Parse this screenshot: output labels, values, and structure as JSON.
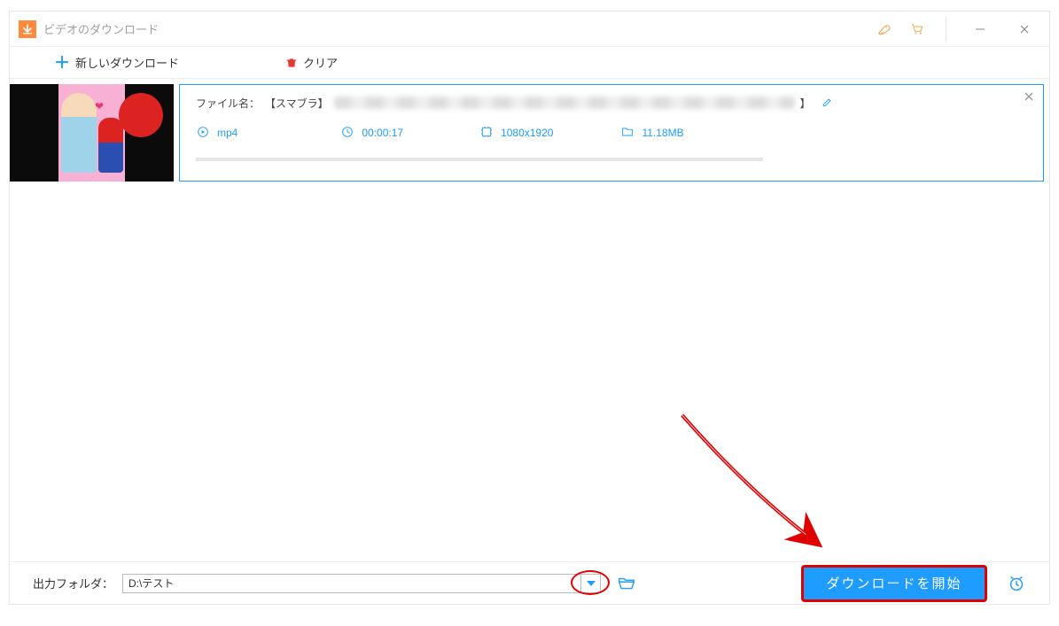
{
  "window": {
    "title": "ビデオのダウンロード"
  },
  "toolbar": {
    "new_download_label": "新しいダウンロード",
    "clear_label": "クリア"
  },
  "item": {
    "filename_label": "ファイル名：",
    "filename_prefix": "【スマブラ】",
    "filename_suffix": "】",
    "format": "mp4",
    "duration": "00:00:17",
    "resolution": "1080x1920",
    "filesize": "11.18MB"
  },
  "footer": {
    "output_folder_label": "出力フォルダ：",
    "output_folder_value": "D:\\テスト",
    "start_download_label": "ダウンロードを開始"
  },
  "colors": {
    "accent": "#1e9cff",
    "annotation_red": "#e00000",
    "app_orange": "#ff8a3d"
  }
}
